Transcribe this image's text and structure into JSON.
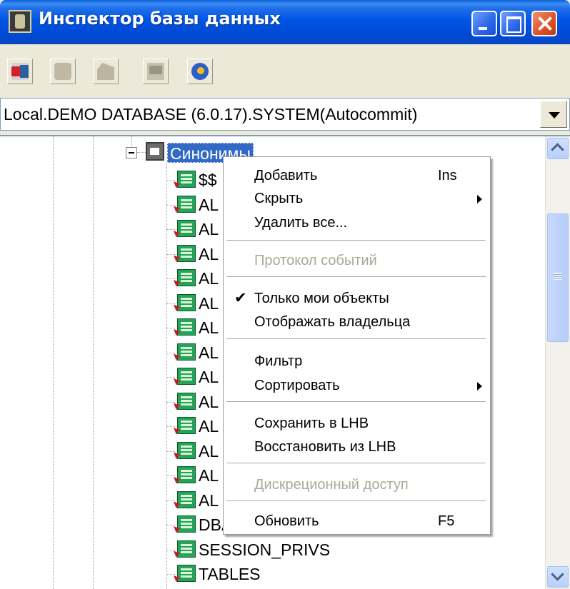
{
  "window": {
    "title": "Инспектор базы данных"
  },
  "connection": {
    "selected": "Local.DEMO DATABASE (6.0.17).SYSTEM(Autocommit)"
  },
  "tree": {
    "selected_node": "Синонимы",
    "children": [
      "$$",
      "AL",
      "AL",
      "AL",
      "AL",
      "AL",
      "AL",
      "AL",
      "AL",
      "AL",
      "AL",
      "AL",
      "AL",
      "AL",
      "DBA_OBJECTS",
      "SESSION_PRIVS",
      "TABLES"
    ]
  },
  "context_menu": {
    "items": [
      {
        "label": "Добавить",
        "shortcut": "Ins"
      },
      {
        "label": "Скрыть"
      },
      {
        "label": "Удалить все..."
      },
      {
        "label": "Протокол событий"
      },
      {
        "label": "Только мои объекты",
        "check": "✔"
      },
      {
        "label": "Отображать владельца"
      },
      {
        "label": "Фильтр"
      },
      {
        "label": "Сортировать"
      },
      {
        "label": "Сохранить в LHB"
      },
      {
        "label": "Восстановить из LHB"
      },
      {
        "label": "Дискреционный доступ"
      },
      {
        "label": "Обновить",
        "shortcut": "F5"
      }
    ]
  },
  "colors": {
    "title_bar": "#0055e5",
    "selection": "#316ac5",
    "disabled_text": "#aca899"
  }
}
